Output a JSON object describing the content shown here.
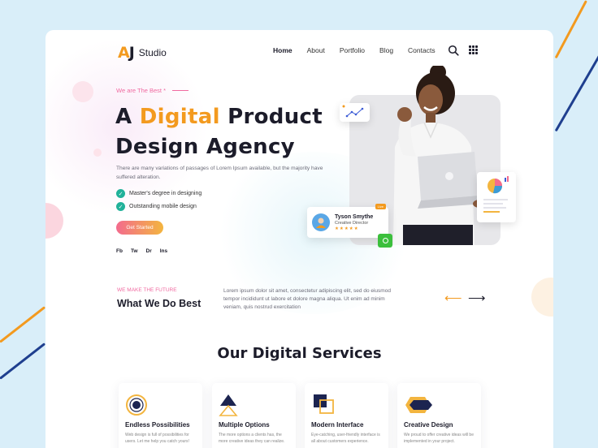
{
  "brand": {
    "mark_left": "A",
    "mark_right": "J",
    "name": "Studio"
  },
  "nav": [
    {
      "label": "Home",
      "active": true
    },
    {
      "label": "About"
    },
    {
      "label": "Portfolio"
    },
    {
      "label": "Blog"
    },
    {
      "label": "Contacts"
    }
  ],
  "hero": {
    "eyebrow": "We are The Best *",
    "headline_prefix": "A",
    "headline_highlight": "Digital",
    "headline_rest": "Product",
    "headline_line2": "Design Agency",
    "description": "There are many variations of passages of Lorem Ipsum available, but the majority have suffered alteration.",
    "checks": [
      "Master's degree in designing",
      "Outstanding mobile design"
    ],
    "cta": "Get Started",
    "social": [
      "Fb",
      "Tw",
      "Dr",
      "Ins"
    ]
  },
  "profile_card": {
    "name": "Tyson Smythe",
    "role": "Creative Director",
    "stars": "★★★★★",
    "badge": "Live"
  },
  "what_we_do": {
    "eyebrow": "WE MAKE THE FUTURE",
    "title": "What We Do Best",
    "text": "Lorem ipsum dolor sit amet, consectetur adipiscing elit, sed do eiusmod tempor incididunt ut labore et dolore magna aliqua. Ut enim ad minim veniam, quis nostrud exercitation"
  },
  "services": {
    "title": "Our Digital Services",
    "items": [
      {
        "name": "Endless Possibilities",
        "desc": "Web design is full of possibilities for users. Let me help you catch yours!"
      },
      {
        "name": "Multiple Options",
        "desc": "The more options a clients has, the more creative ideas they can realize."
      },
      {
        "name": "Modern Interface",
        "desc": "Eye-catching, user-friendly interface is all about customers experience."
      },
      {
        "name": "Creative Design",
        "desc": "We proud to offer creative ideas will be implemented in your project."
      }
    ]
  },
  "colors": {
    "accent": "#f39a1f",
    "pink": "#f06aa0",
    "green": "#21b29a",
    "dark": "#1c1c2a",
    "background": "#d9eef9"
  }
}
